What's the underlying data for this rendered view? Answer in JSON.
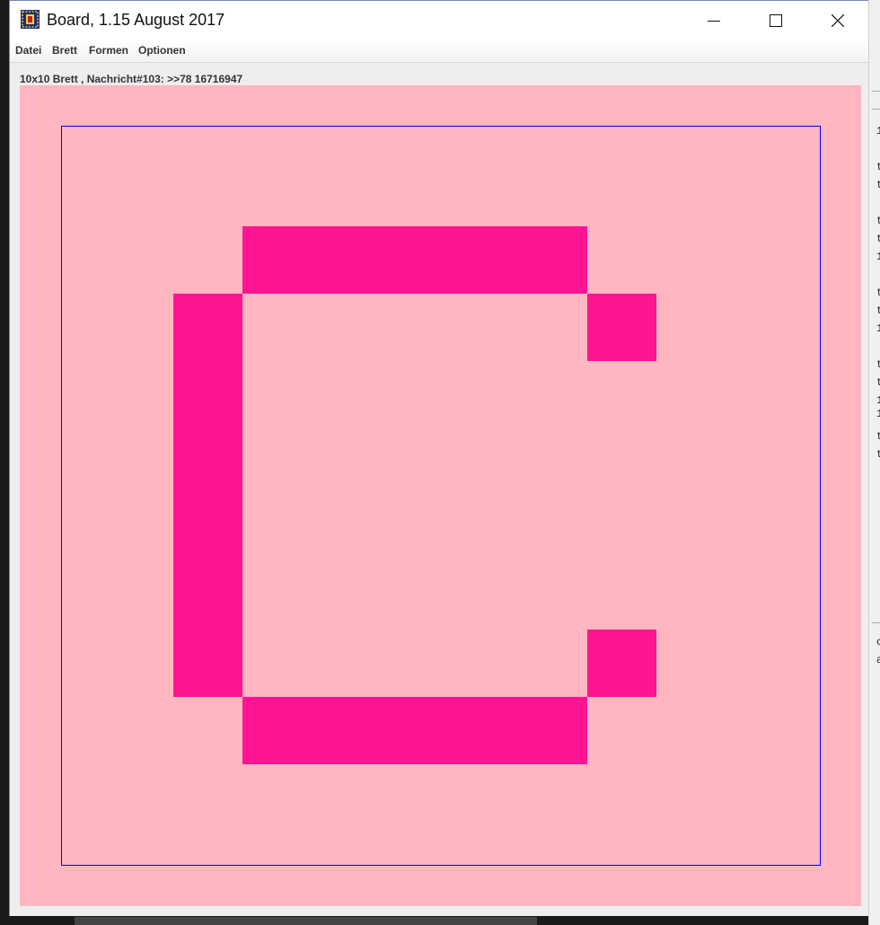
{
  "window": {
    "title": "Board, 1.15 August 2017",
    "icon": "board-app-icon"
  },
  "menu": {
    "items": [
      "Datei",
      "Brett",
      "Formen",
      "Optionen"
    ]
  },
  "status": {
    "text": "10x10 Brett , Nachricht#103: >>78 16716947"
  },
  "board": {
    "rows": 10,
    "cols": 10,
    "background_color": "#ffb6c1",
    "frame_color": "#0000ff",
    "cell_color": "#ff1493",
    "filled_cells": [
      [
        2,
        3
      ],
      [
        2,
        4
      ],
      [
        2,
        5
      ],
      [
        2,
        6
      ],
      [
        2,
        7
      ],
      [
        3,
        2
      ],
      [
        3,
        8
      ],
      [
        4,
        2
      ],
      [
        5,
        2
      ],
      [
        6,
        2
      ],
      [
        7,
        2
      ],
      [
        8,
        2
      ],
      [
        8,
        8
      ],
      [
        9,
        3
      ],
      [
        9,
        4
      ],
      [
        9,
        5
      ],
      [
        9,
        6
      ],
      [
        9,
        7
      ]
    ]
  },
  "background_app": {
    "text_fragments": [
      "1",
      "t",
      "t",
      "t",
      "t",
      "1",
      "t",
      "t",
      "1",
      "t",
      "t",
      "1",
      "1",
      "t",
      "t",
      "c",
      "a"
    ]
  }
}
